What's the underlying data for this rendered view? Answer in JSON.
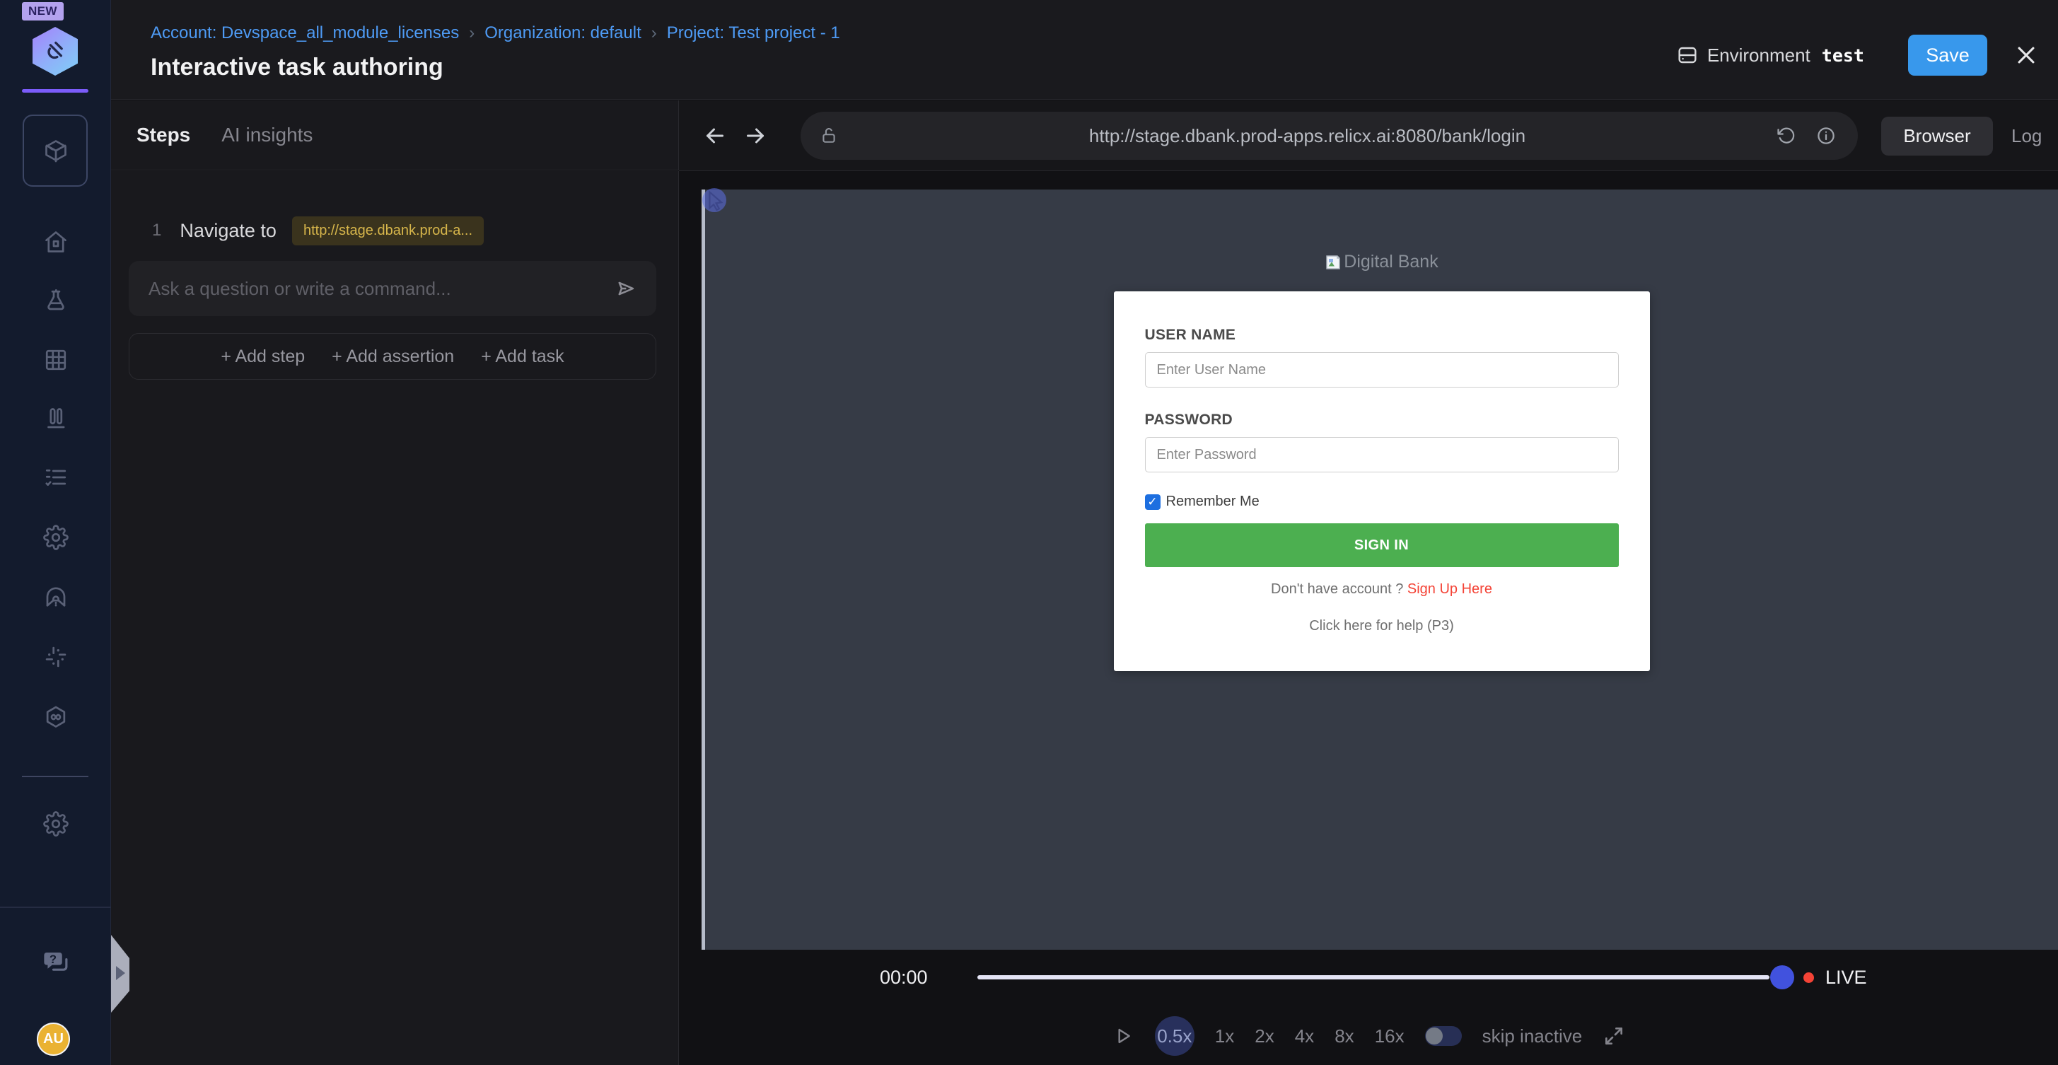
{
  "app": {
    "new_badge": "NEW",
    "title": "Interactive task authoring",
    "breadcrumb": [
      "Account: Devspace_all_module_licenses",
      "Organization: default",
      "Project: Test project - 1"
    ],
    "crumb_sep": "›",
    "environment_label": "Environment",
    "environment_value": "test",
    "save_label": "Save"
  },
  "sidebar": {
    "icons": [
      "package-cube-icon",
      "home-icon",
      "flask-icon",
      "grid-icon",
      "test-tubes-icon",
      "checklist-icon",
      "gear-icon",
      "tunnel-icon",
      "integrations-slack-icon",
      "hexagon-infinity-icon",
      "gear-icon",
      "chat-help-icon"
    ],
    "avatar_initials": "AU"
  },
  "steps_panel": {
    "tabs": [
      "Steps",
      "AI insights"
    ],
    "active_tab": "Steps",
    "step_number": "1",
    "step_action": "Navigate to",
    "step_url_chip": "http://stage.dbank.prod-a...",
    "command_placeholder": "Ask a question or write a command...",
    "add_step": "+ Add step",
    "add_assertion": "+ Add assertion",
    "add_task": "+ Add task"
  },
  "browser": {
    "url": "http://stage.dbank.prod-apps.relicx.ai:8080/bank/login",
    "tabs": [
      "Browser",
      "Log"
    ],
    "active_tab": "Browser"
  },
  "login_page": {
    "logo_alt": "Digital Bank",
    "username_label": "USER NAME",
    "username_placeholder": "Enter User Name",
    "password_label": "PASSWORD",
    "password_placeholder": "Enter Password",
    "remember_label": "Remember Me",
    "remember_checked": "checked",
    "check_glyph": "✓",
    "sign_in_label": "SIGN IN",
    "signup_text": "Don't have account ? ",
    "signup_link": "Sign Up Here",
    "help_text": "Click here for help (P3)"
  },
  "player": {
    "time": "00:00",
    "live_label": "LIVE",
    "speeds": [
      "0.5x",
      "1x",
      "2x",
      "4x",
      "8x",
      "16x"
    ],
    "selected_speed": "0.5x",
    "skip_inactive_label": "skip inactive"
  },
  "colors": {
    "accent_blue": "#3898ec",
    "breadcrumb_blue": "#4e9bf5",
    "chip_yellow": "#d7b64b",
    "signin_green": "#4caf50",
    "link_red": "#f44336",
    "thumb_blue": "#4152de",
    "avatar_yellow": "#eab232",
    "sidebar_navy": "#131b2d",
    "viewport_slate": "#363b46"
  }
}
